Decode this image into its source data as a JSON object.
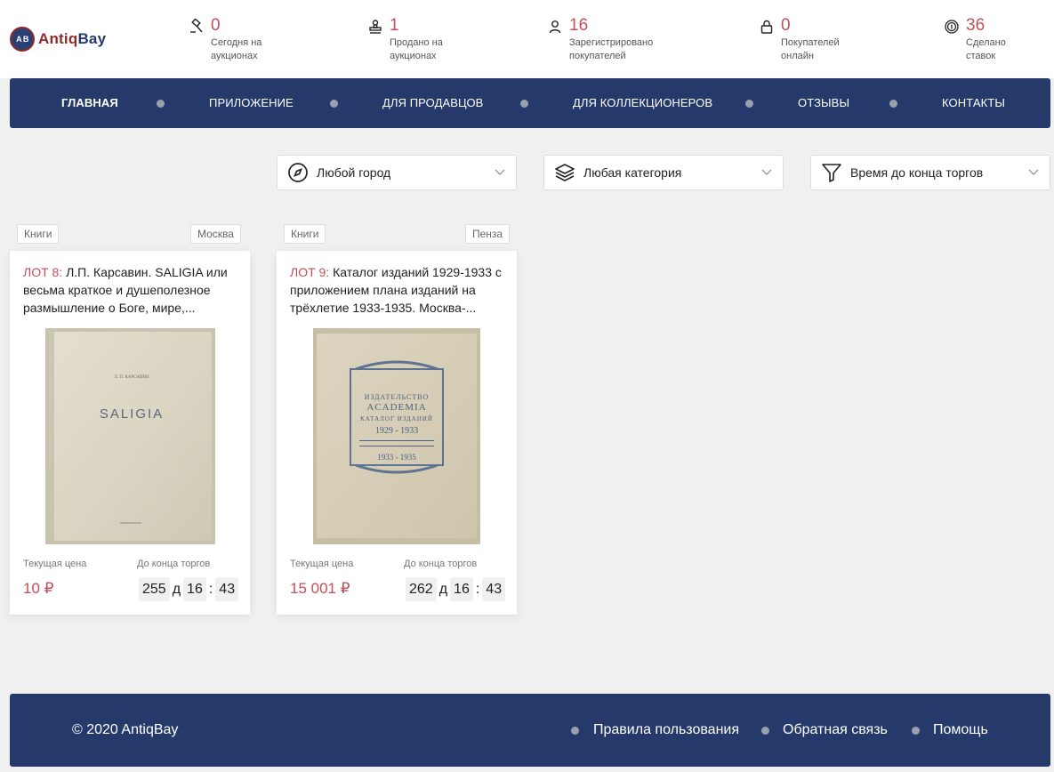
{
  "brand": {
    "logo_mark": "A B",
    "name_part1": "Antiq",
    "name_part2": "Bay"
  },
  "stats": [
    {
      "icon": "gavel-icon",
      "value": "0",
      "label": "Сегодня на аукционах"
    },
    {
      "icon": "stamp-icon",
      "value": "1",
      "label": "Продано на аукционах"
    },
    {
      "icon": "user-icon",
      "value": "16",
      "label": "Зарегистрировано покупателей"
    },
    {
      "icon": "lock-icon",
      "value": "0",
      "label": "Покупателей онлайн"
    },
    {
      "icon": "coin-icon",
      "value": "36",
      "label": "Сделано ставок"
    }
  ],
  "nav": {
    "items": [
      {
        "label": "ГЛАВНАЯ",
        "active": true
      },
      {
        "label": "ПРИЛОЖЕНИЕ"
      },
      {
        "label": "ДЛЯ ПРОДАВЦОВ"
      },
      {
        "label": "ДЛЯ КОЛЛЕКЦИОНЕРОВ"
      },
      {
        "label": "ОТЗЫВЫ"
      },
      {
        "label": "КОНТАКТЫ"
      }
    ]
  },
  "filters": {
    "city": "Любой город",
    "category": "Любая категория",
    "time": "Время до конца торгов"
  },
  "lots": [
    {
      "category": "Книги",
      "city": "Москва",
      "lot_label": "ЛОТ 8:",
      "title": " Л.П. Карсавин. SALIGIA или весьма краткое и душеполезное размышление о Боге, мире,...",
      "image_text": "SALIGIA",
      "image_author": "Л. П. КАРСАВИН",
      "price_label": "Текущая цена",
      "time_label": "До конца торгов",
      "price": "10 ₽",
      "days": "255",
      "days_unit": "д",
      "hours": "16",
      "minutes": "43"
    },
    {
      "category": "Книги",
      "city": "Пенза",
      "lot_label": "ЛОТ 9:",
      "title": " Каталог изданий 1929-1933 с приложением плана изданий на трёхлетие 1933-1935. Москва-...",
      "image_text_1": "ИЗДАТЕЛЬСТВО",
      "image_text_2": "ACADEMIA",
      "image_text_3": "КАТАЛОГ ИЗДАНИЙ",
      "image_text_4": "1929 - 1933",
      "image_text_5": "1933 - 1935",
      "price_label": "Текущая цена",
      "time_label": "До конца торгов",
      "price": "15 001 ₽",
      "days": "262",
      "days_unit": "д",
      "hours": "16",
      "minutes": "43"
    }
  ],
  "footer": {
    "copyright": "© 2020 AntiqBay",
    "links": [
      "Правила пользования",
      "Обратная связь",
      "Помощь"
    ]
  },
  "colors": {
    "navy": "#25396b",
    "accent": "#c0505a"
  }
}
